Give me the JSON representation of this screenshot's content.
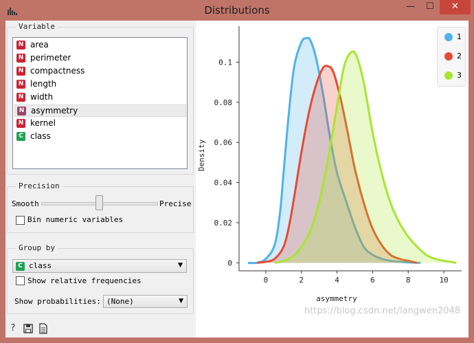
{
  "window": {
    "title": "Distributions",
    "min_glyph": "—",
    "max_glyph": "☐",
    "close_glyph": "✕"
  },
  "variable": {
    "title": "Variable",
    "items": [
      {
        "badge": "N",
        "label": "area"
      },
      {
        "badge": "N",
        "label": "perimeter"
      },
      {
        "badge": "N",
        "label": "compactness"
      },
      {
        "badge": "N",
        "label": "length"
      },
      {
        "badge": "N",
        "label": "width"
      },
      {
        "badge": "N",
        "label": "asymmetry"
      },
      {
        "badge": "N",
        "label": "kernel"
      },
      {
        "badge": "C",
        "label": "class"
      }
    ],
    "selected": "asymmetry"
  },
  "precision": {
    "title": "Precision",
    "smooth_label": "Smooth",
    "precise_label": "Precise",
    "slider_value": 0.5,
    "bin_label": "Bin numeric variables"
  },
  "group_by": {
    "title": "Group by",
    "badge": "C",
    "value": "class",
    "relative_label": "Show relative frequencies",
    "prob_label": "Show probabilities:",
    "prob_value": "(None)"
  },
  "icons": [
    "help-icon",
    "save-icon",
    "report-icon"
  ],
  "watermark": "https://blog.csdn.net/langwen2048",
  "colors": {
    "s1": "#4fb2ea",
    "s2": "#e64a33",
    "s3": "#a7e630"
  },
  "chart_data": {
    "type": "area",
    "xlabel": "asymmetry",
    "ylabel": "Density",
    "xlim": [
      -1.5,
      11
    ],
    "ylim": [
      -0.004,
      0.118
    ],
    "xticks": [
      "0",
      "2",
      "4",
      "6",
      "8",
      "10"
    ],
    "xtick_values": [
      0,
      2,
      4,
      6,
      8,
      10
    ],
    "yticks": [
      "0",
      "0.02",
      "0.04",
      "0.06",
      "0.08",
      "0.1"
    ],
    "ytick_values": [
      0,
      0.02,
      0.04,
      0.06,
      0.08,
      0.1
    ],
    "legend": "top-right",
    "series": [
      {
        "name": "1",
        "color": "#4fb2ea",
        "x": [
          -1.0,
          -0.5,
          0,
          0.5,
          0.8,
          1.0,
          1.3,
          1.6,
          2.0,
          2.3,
          2.5,
          2.8,
          3.2,
          3.6,
          4.0,
          4.5,
          5.0,
          5.5,
          6.0,
          6.5,
          7.0,
          7.5,
          8.0,
          8.7
        ],
        "y": [
          0,
          0,
          0.002,
          0.009,
          0.025,
          0.045,
          0.075,
          0.098,
          0.11,
          0.112,
          0.111,
          0.103,
          0.085,
          0.063,
          0.045,
          0.031,
          0.018,
          0.008,
          0.004,
          0.002,
          0.001,
          0.0005,
          0.0002,
          0
        ]
      },
      {
        "name": "2",
        "color": "#e64a33",
        "x": [
          -0.5,
          0,
          0.5,
          1.0,
          1.3,
          1.6,
          2.0,
          2.4,
          2.8,
          3.2,
          3.5,
          3.8,
          4.2,
          4.6,
          5.0,
          5.5,
          6.0,
          6.5,
          7.0,
          7.5,
          8.0,
          8.5
        ],
        "y": [
          0,
          0.0005,
          0.002,
          0.008,
          0.018,
          0.033,
          0.055,
          0.074,
          0.088,
          0.097,
          0.098,
          0.095,
          0.082,
          0.065,
          0.047,
          0.03,
          0.017,
          0.009,
          0.004,
          0.002,
          0.001,
          0
        ]
      },
      {
        "name": "3",
        "color": "#a7e630",
        "x": [
          0.5,
          1.0,
          1.5,
          2.0,
          2.5,
          3.0,
          3.5,
          4.0,
          4.4,
          4.8,
          5.1,
          5.5,
          6.0,
          6.5,
          7.0,
          7.5,
          8.0,
          8.5,
          9.0,
          9.5,
          10.0,
          10.7
        ],
        "y": [
          0,
          0.001,
          0.003,
          0.008,
          0.016,
          0.03,
          0.052,
          0.078,
          0.098,
          0.105,
          0.103,
          0.09,
          0.065,
          0.045,
          0.03,
          0.02,
          0.013,
          0.008,
          0.004,
          0.002,
          0.001,
          0
        ]
      }
    ]
  }
}
